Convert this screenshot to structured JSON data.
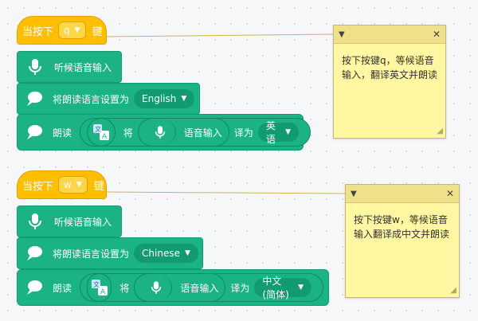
{
  "scripts": [
    {
      "hat": {
        "prefix": "当按下",
        "key": "q",
        "suffix": "键"
      },
      "listen": {
        "label": "听候语音输入"
      },
      "setLang": {
        "label": "将朗读语言设置为",
        "value": "English"
      },
      "speak": {
        "label": "朗读",
        "connector": "将",
        "reporter": "语音输入",
        "translate_to": "译为",
        "target": "英语"
      },
      "note": {
        "text": "按下按键q，等候语音输入，翻译英文并朗读"
      }
    },
    {
      "hat": {
        "prefix": "当按下",
        "key": "w",
        "suffix": "键"
      },
      "listen": {
        "label": "听候语音输入"
      },
      "setLang": {
        "label": "将朗读语言设置为",
        "value": "Chinese"
      },
      "speak": {
        "label": "朗读",
        "connector": "将",
        "reporter": "语音输入",
        "translate_to": "译为",
        "target": "中文(简体)"
      },
      "note": {
        "text": "按下按键w，等候语音输入翻译成中文并朗读"
      }
    }
  ],
  "icons": {
    "note_collapse": "caret-down-icon",
    "note_close": "close-icon",
    "mic": "microphone-icon",
    "speech": "speech-bubble-icon",
    "translate": "translate-icon"
  },
  "colors": {
    "hat": "#ffbf00",
    "green_block": "#1bb384",
    "note": "#fff7a1"
  }
}
